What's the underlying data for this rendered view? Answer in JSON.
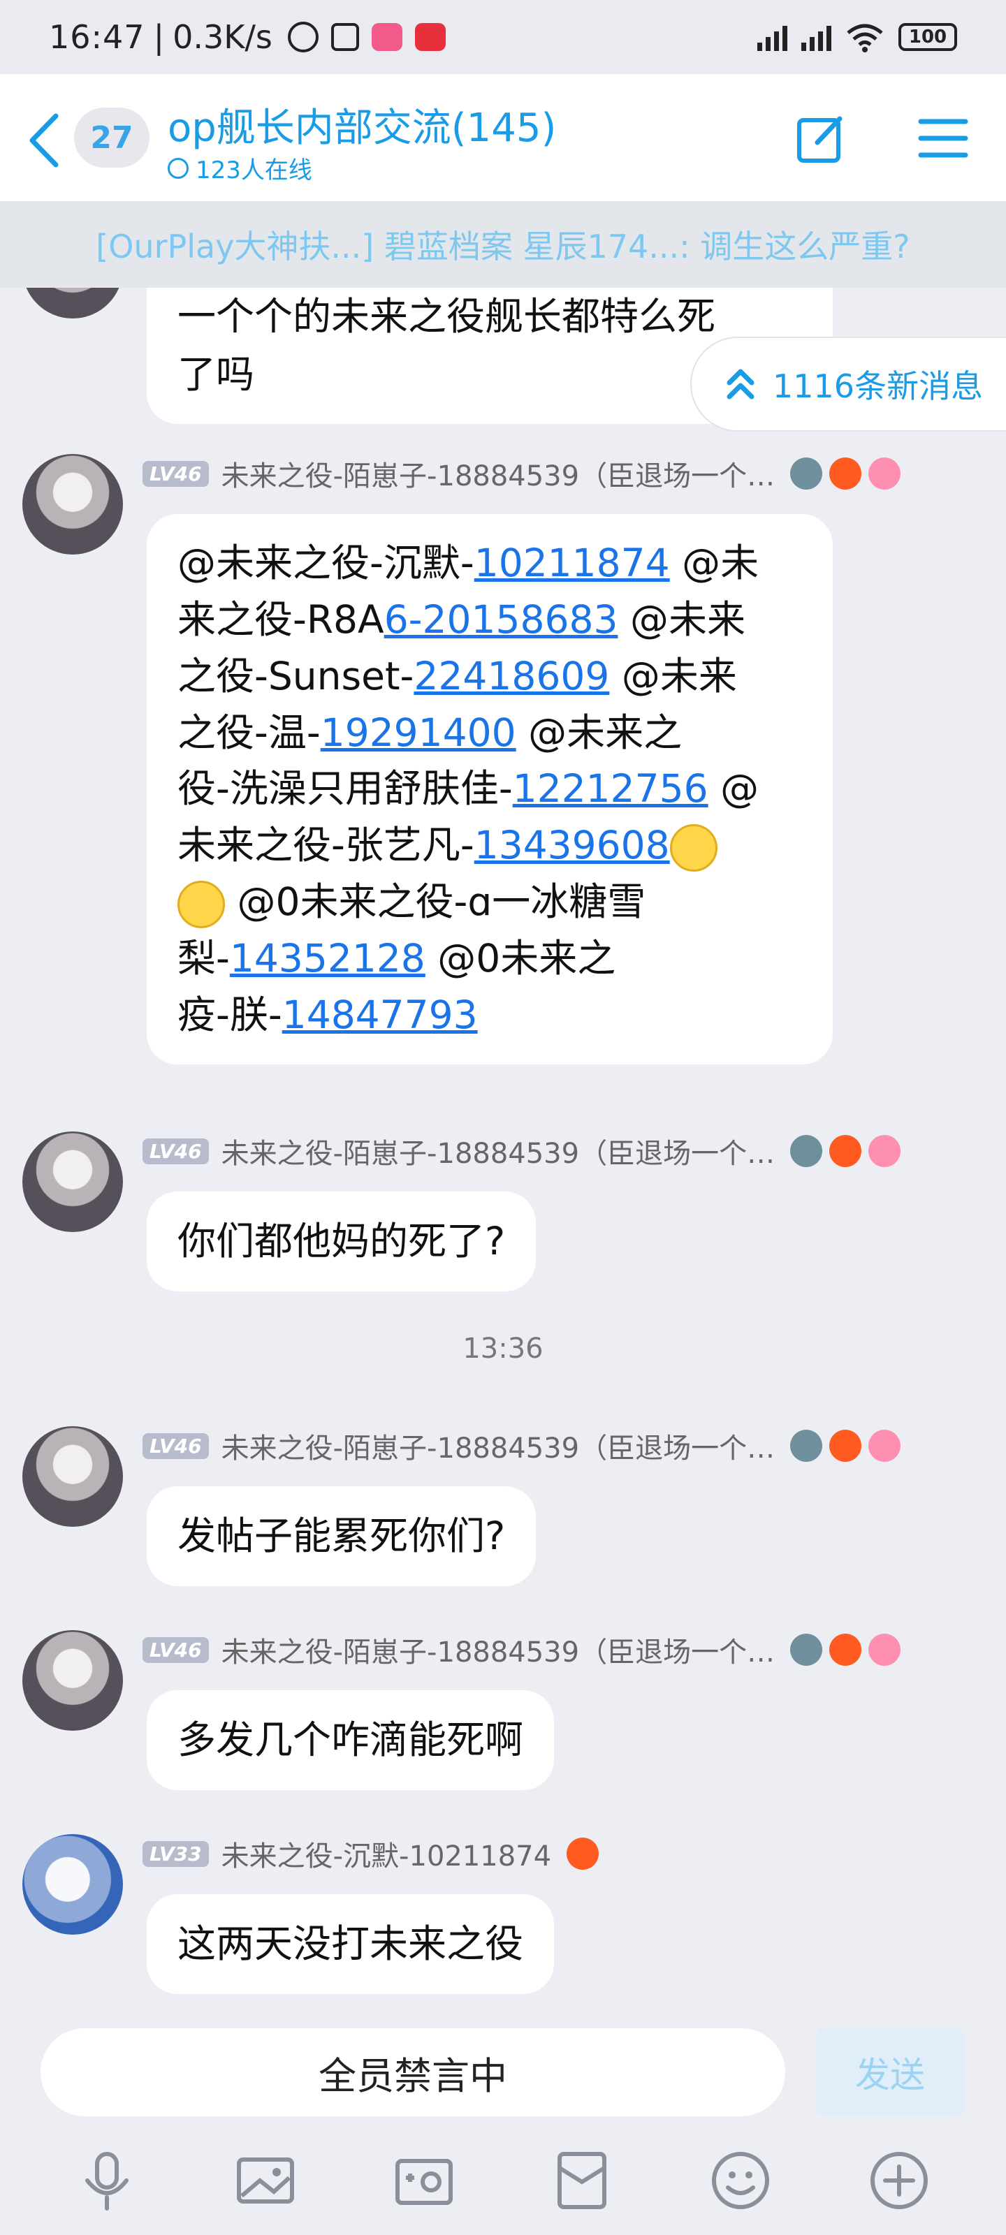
{
  "status_bar": {
    "time": "16:47",
    "speed": "0.3K/s",
    "battery": "100"
  },
  "header": {
    "unread_count": "27",
    "title": "op舰长内部交流(145)",
    "online": "123人在线"
  },
  "banner": {
    "text": "[OurPlay大神扶...] 碧蓝档案 星辰174...: 调生这么严重?"
  },
  "new_messages": {
    "label": "1116条新消息"
  },
  "messages": [
    {
      "lines": [
        "一个个的未来之役舰长都特么死",
        "了吗"
      ]
    },
    {
      "level": "LV46",
      "sender": "未来之役-陌崽子-18884539（臣退场一个…",
      "segments": [
        {
          "t": "@未来之役-沉默-"
        },
        {
          "t": "10211874",
          "link": true
        },
        {
          "t": " @未"
        },
        {
          "br": true
        },
        {
          "t": "来之役-R8A"
        },
        {
          "t": "6-20158683",
          "link": true
        },
        {
          "t": " @未来"
        },
        {
          "br": true
        },
        {
          "t": "之役-Sunset-"
        },
        {
          "t": "22418609",
          "link": true
        },
        {
          "t": " @未来"
        },
        {
          "br": true
        },
        {
          "t": "之役-温-"
        },
        {
          "t": "19291400",
          "link": true
        },
        {
          "t": " @未来之"
        },
        {
          "br": true
        },
        {
          "t": "役-洗澡只用舒肤佳-"
        },
        {
          "t": "12212756",
          "link": true
        },
        {
          "t": " @"
        },
        {
          "br": true
        },
        {
          "t": "未来之役-张艺凡-"
        },
        {
          "t": "13439608",
          "link": true
        },
        {
          "emoji": true
        },
        {
          "br": true
        },
        {
          "emoji": true
        },
        {
          "t": " @0未来之役-ɑ一冰糖雪"
        },
        {
          "br": true
        },
        {
          "t": "梨-"
        },
        {
          "t": "14352128",
          "link": true
        },
        {
          "t": " @0未来之"
        },
        {
          "br": true
        },
        {
          "t": "疫-朕-"
        },
        {
          "t": "14847793",
          "link": true
        }
      ]
    },
    {
      "level": "LV46",
      "sender": "未来之役-陌崽子-18884539（臣退场一个…",
      "text": "你们都他妈的死了?"
    },
    {
      "level": "LV46",
      "sender": "未来之役-陌崽子-18884539（臣退场一个…",
      "text": "发帖子能累死你们?"
    },
    {
      "level": "LV46",
      "sender": "未来之役-陌崽子-18884539（臣退场一个…",
      "text": "多发几个咋滴能死啊"
    },
    {
      "level": "LV33",
      "sender": "未来之役-沉默-10211874",
      "text": "这两天没打未来之役"
    }
  ],
  "timestamp": "13:36",
  "input": {
    "placeholder": "全员禁言中",
    "send_label": "发送"
  },
  "toolbar_icons": [
    "microphone-icon",
    "image-icon",
    "camera-icon",
    "red-packet-icon",
    "emoji-icon",
    "plus-icon"
  ],
  "colors": {
    "accent": "#1a9be6",
    "link": "#1a73e8",
    "background": "#eceef3"
  }
}
